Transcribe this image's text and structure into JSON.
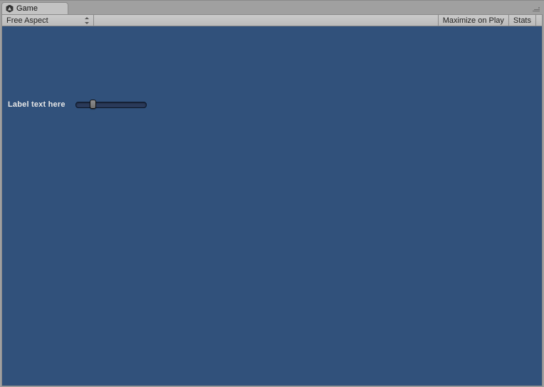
{
  "tab": {
    "label": "Game"
  },
  "toolbar": {
    "aspect_dropdown": {
      "label": "Free Aspect"
    },
    "maximize_label": "Maximize on Play",
    "stats_label": "Stats"
  },
  "gameview": {
    "label_text": "Label text here",
    "slider": {
      "value": 0.2,
      "min": 0,
      "max": 1
    }
  }
}
